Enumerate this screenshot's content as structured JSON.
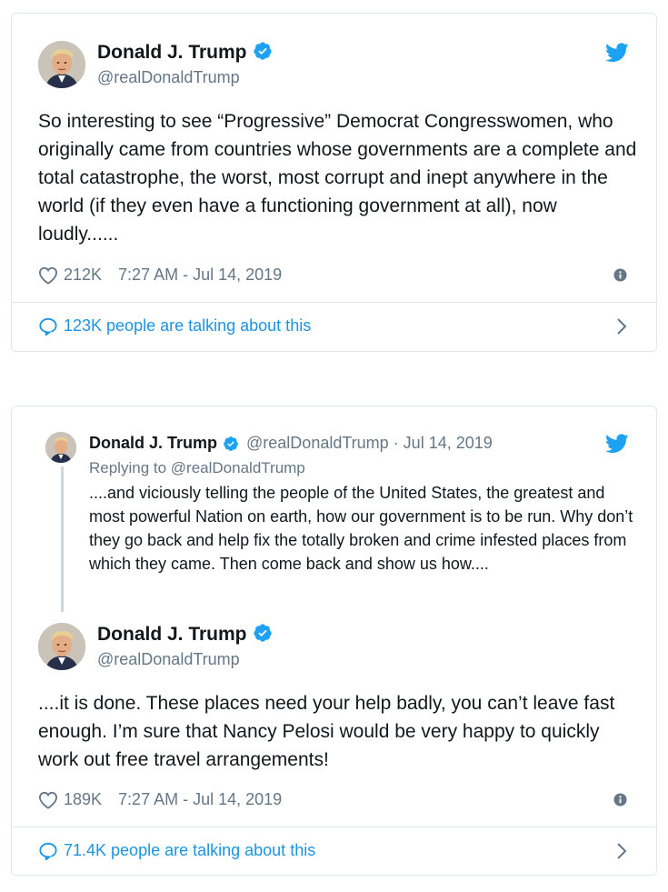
{
  "colors": {
    "twitter_blue": "#1da1f2",
    "link_blue": "#1b95e0",
    "muted": "#657786",
    "border": "#e1e8ed"
  },
  "tweet1": {
    "name": "Donald J. Trump",
    "handle": "@realDonaldTrump",
    "text": "So interesting to see “Progressive” Democrat Congresswomen, who originally came from countries whose governments are a complete and total catastrophe, the worst, most corrupt and inept anywhere in the world (if they even have a functioning government at all), now loudly......",
    "likes": "212K",
    "timestamp": "7:27 AM - Jul 14, 2019",
    "talking": "123K people are talking about this",
    "icons": [
      "twitter-bird-icon",
      "verified-badge-icon",
      "heart-icon",
      "info-icon",
      "comment-bubble-icon",
      "chevron-right-icon"
    ]
  },
  "tweet2": {
    "parent": {
      "name": "Donald J. Trump",
      "handle_date": "@realDonaldTrump · Jul 14, 2019",
      "replying_label": "Replying to",
      "replying_handle": "@realDonaldTrump",
      "text": "....and viciously telling the people of the United States, the greatest and most powerful Nation on earth, how our government is to be run. Why don’t they go back and help fix the totally broken and crime infested places from which they came. Then come back and show us how...."
    },
    "name": "Donald J. Trump",
    "handle": "@realDonaldTrump",
    "text": "....it is done. These places need your help badly, you can’t leave fast enough. I’m sure that Nancy Pelosi would be very happy to quickly work out free travel arrangements!",
    "likes": "189K",
    "timestamp": "7:27 AM - Jul 14, 2019",
    "talking": "71.4K people are talking about this"
  }
}
